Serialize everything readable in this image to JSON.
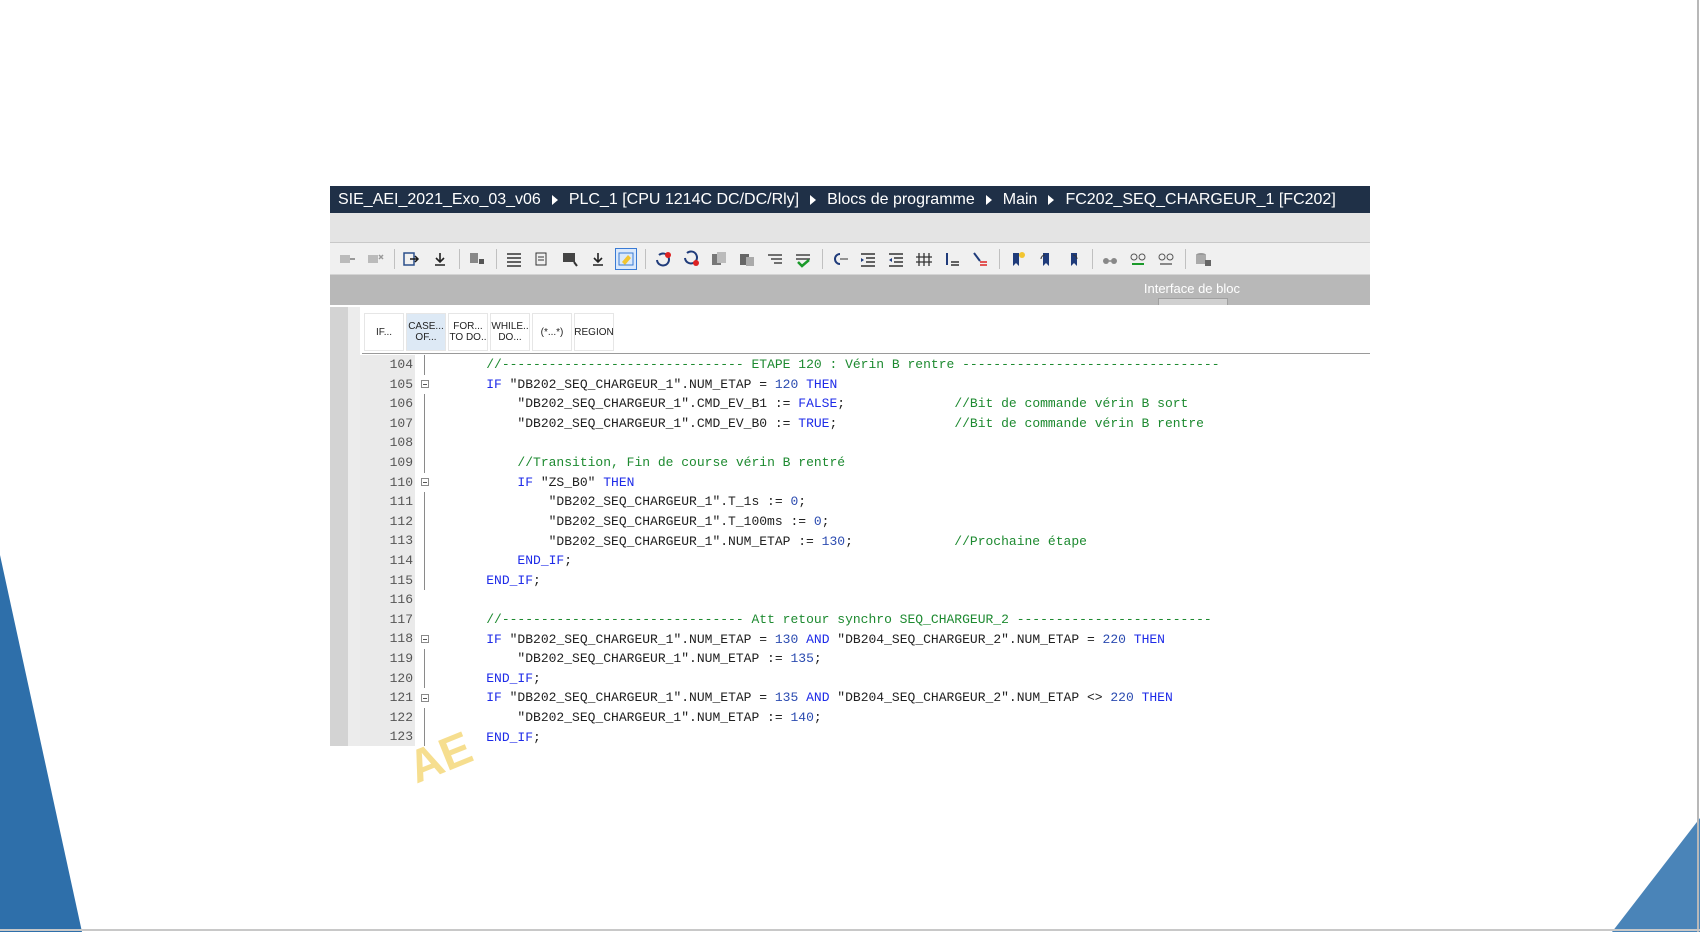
{
  "breadcrumb": {
    "items": [
      "SIE_AEI_2021_Exo_03_v06",
      "PLC_1 [CPU 1214C DC/DC/Rly]",
      "Blocs de programme",
      "Main",
      "FC202_SEQ_CHARGEUR_1 [FC202]"
    ]
  },
  "interface_bar": {
    "label": "Interface de bloc"
  },
  "keyword_bar": {
    "buttons": [
      "IF...",
      "CASE...\nOF...",
      "FOR...\nTO DO..",
      "WHILE..\nDO...",
      "(*...*)",
      "REGION"
    ]
  },
  "colors": {
    "title_bg": "#1f3047",
    "keyword": "#1e2be8",
    "comment": "#1d8a30",
    "deco_blue": "#2e6faa"
  },
  "code": {
    "lines": [
      {
        "n": "104",
        "fold": "line",
        "segs": [
          [
            "    ",
            ""
          ],
          [
            "//------------------------------- ETAPE 120 : Vérin B rentre ---------------------------------",
            "cm"
          ]
        ]
      },
      {
        "n": "105",
        "fold": "box",
        "segs": [
          [
            "    ",
            ""
          ],
          [
            "IF",
            "kw"
          ],
          [
            " \"DB202_SEQ_CHARGEUR_1\".NUM_ETAP = ",
            ""
          ],
          [
            "120",
            "nm"
          ],
          [
            " ",
            ""
          ],
          [
            "THEN",
            "kw"
          ]
        ]
      },
      {
        "n": "106",
        "fold": "line",
        "segs": [
          [
            "        \"DB202_SEQ_CHARGEUR_1\".CMD_EV_B1 := ",
            ""
          ],
          [
            "FALSE",
            "kw"
          ],
          [
            ";              ",
            ""
          ],
          [
            "//Bit de commande vérin B sort",
            "cm"
          ]
        ]
      },
      {
        "n": "107",
        "fold": "line",
        "segs": [
          [
            "        \"DB202_SEQ_CHARGEUR_1\".CMD_EV_B0 := ",
            ""
          ],
          [
            "TRUE",
            "kw"
          ],
          [
            ";               ",
            ""
          ],
          [
            "//Bit de commande vérin B rentre",
            "cm"
          ]
        ]
      },
      {
        "n": "108",
        "fold": "line",
        "segs": [
          [
            "",
            ""
          ]
        ]
      },
      {
        "n": "109",
        "fold": "line",
        "segs": [
          [
            "        ",
            ""
          ],
          [
            "//Transition, Fin de course vérin B rentré",
            "cm"
          ]
        ]
      },
      {
        "n": "110",
        "fold": "box",
        "segs": [
          [
            "        ",
            ""
          ],
          [
            "IF",
            "kw"
          ],
          [
            " \"ZS_B0\" ",
            ""
          ],
          [
            "THEN",
            "kw"
          ]
        ]
      },
      {
        "n": "111",
        "fold": "line",
        "segs": [
          [
            "            \"DB202_SEQ_CHARGEUR_1\".T_1s := ",
            ""
          ],
          [
            "0",
            "nm"
          ],
          [
            ";",
            ""
          ]
        ]
      },
      {
        "n": "112",
        "fold": "line",
        "segs": [
          [
            "            \"DB202_SEQ_CHARGEUR_1\".T_100ms := ",
            ""
          ],
          [
            "0",
            "nm"
          ],
          [
            ";",
            ""
          ]
        ]
      },
      {
        "n": "113",
        "fold": "line",
        "segs": [
          [
            "            \"DB202_SEQ_CHARGEUR_1\".NUM_ETAP := ",
            ""
          ],
          [
            "130",
            "nm"
          ],
          [
            ";             ",
            ""
          ],
          [
            "//Prochaine étape",
            "cm"
          ]
        ]
      },
      {
        "n": "114",
        "fold": "line",
        "segs": [
          [
            "        ",
            ""
          ],
          [
            "END_IF",
            "kw"
          ],
          [
            ";",
            ""
          ]
        ]
      },
      {
        "n": "115",
        "fold": "line",
        "segs": [
          [
            "    ",
            ""
          ],
          [
            "END_IF",
            "kw"
          ],
          [
            ";",
            ""
          ]
        ]
      },
      {
        "n": "116",
        "fold": "none",
        "segs": [
          [
            "",
            ""
          ]
        ]
      },
      {
        "n": "117",
        "fold": "none",
        "segs": [
          [
            "    ",
            ""
          ],
          [
            "//------------------------------- Att retour synchro SEQ_CHARGEUR_2 -------------------------",
            "cm"
          ]
        ]
      },
      {
        "n": "118",
        "fold": "box",
        "segs": [
          [
            "    ",
            ""
          ],
          [
            "IF",
            "kw"
          ],
          [
            " \"DB202_SEQ_CHARGEUR_1\".NUM_ETAP = ",
            ""
          ],
          [
            "130",
            "nm"
          ],
          [
            " ",
            ""
          ],
          [
            "AND",
            "kw"
          ],
          [
            " \"DB204_SEQ_CHARGEUR_2\".NUM_ETAP = ",
            ""
          ],
          [
            "220",
            "nm"
          ],
          [
            " ",
            ""
          ],
          [
            "THEN",
            "kw"
          ]
        ]
      },
      {
        "n": "119",
        "fold": "line",
        "segs": [
          [
            "        \"DB202_SEQ_CHARGEUR_1\".NUM_ETAP := ",
            ""
          ],
          [
            "135",
            "nm"
          ],
          [
            ";",
            ""
          ]
        ]
      },
      {
        "n": "120",
        "fold": "line",
        "segs": [
          [
            "    ",
            ""
          ],
          [
            "END_IF",
            "kw"
          ],
          [
            ";",
            ""
          ]
        ]
      },
      {
        "n": "121",
        "fold": "box",
        "segs": [
          [
            "    ",
            ""
          ],
          [
            "IF",
            "kw"
          ],
          [
            " \"DB202_SEQ_CHARGEUR_1\".NUM_ETAP = ",
            ""
          ],
          [
            "135",
            "nm"
          ],
          [
            " ",
            ""
          ],
          [
            "AND",
            "kw"
          ],
          [
            " \"DB204_SEQ_CHARGEUR_2\".NUM_ETAP <> ",
            ""
          ],
          [
            "220",
            "nm"
          ],
          [
            " ",
            ""
          ],
          [
            "THEN",
            "kw"
          ]
        ]
      },
      {
        "n": "122",
        "fold": "line",
        "segs": [
          [
            "        \"DB202_SEQ_CHARGEUR_1\".NUM_ETAP := ",
            ""
          ],
          [
            "140",
            "nm"
          ],
          [
            ";",
            ""
          ]
        ]
      },
      {
        "n": "123",
        "fold": "line",
        "segs": [
          [
            "    ",
            ""
          ],
          [
            "END_IF",
            "kw"
          ],
          [
            ";",
            ""
          ]
        ]
      }
    ]
  }
}
